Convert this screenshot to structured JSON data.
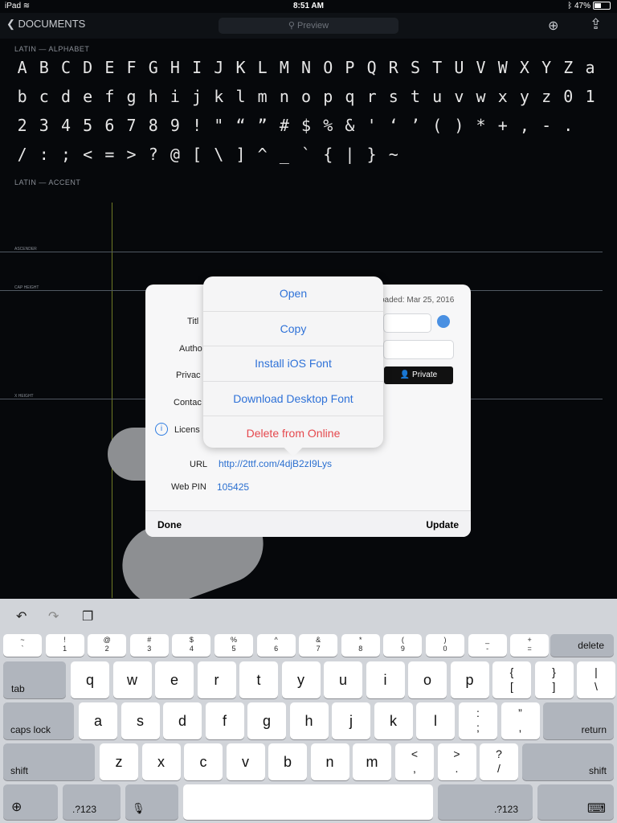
{
  "status": {
    "device": "iPad",
    "wifi": "wifi-icon",
    "time": "8:51 AM",
    "bluetooth": "bluetooth-icon",
    "battery": "47%"
  },
  "nav": {
    "back_label": "DOCUMENTS",
    "search_placeholder": "Preview"
  },
  "glyphs": {
    "section1": "LATIN — ALPHABET",
    "section2": "LATIN — ACCENT",
    "rows": [
      [
        "A",
        "B",
        "C",
        "D",
        "E",
        "F",
        "G",
        "H",
        "I",
        "J",
        "K",
        "L",
        "M",
        "N",
        "O",
        "P",
        "Q",
        "R",
        "S",
        "T",
        "U",
        "V",
        "W",
        "X",
        "Y",
        "Z",
        "a"
      ],
      [
        "b",
        "c",
        "d",
        "e",
        "f",
        "g",
        "h",
        "i",
        "j",
        "k",
        "l",
        "m",
        "n",
        "o",
        "p",
        "q",
        "r",
        "s",
        "t",
        "u",
        "v",
        "w",
        "x",
        "y",
        "z",
        "0",
        "1"
      ],
      [
        "2",
        "3",
        "4",
        "5",
        "6",
        "7",
        "8",
        "9",
        "!",
        "\"",
        "“",
        "”",
        "#",
        "$",
        "%",
        "&",
        "'",
        "‘",
        "’",
        "(",
        ")",
        "*",
        "+",
        ",",
        "-",
        "."
      ],
      [
        "/",
        ":",
        ";",
        "<",
        "=",
        ">",
        "?",
        "@",
        "[",
        "\\",
        "]",
        "^",
        "_",
        "`",
        "{",
        "|",
        "}",
        "~"
      ]
    ]
  },
  "canvas": {
    "ascender": "ASCENDER",
    "cap_height": "CAP HEIGHT",
    "x_height": "X HEIGHT"
  },
  "sheet": {
    "uploaded": "oaded: Mar 25, 2016",
    "title_label": "Titl",
    "author_label": "Autho",
    "privacy_label": "Privac",
    "contact_label": "Contac",
    "license_label": "Licens",
    "private_button": "Private",
    "url_label": "URL",
    "url_value": "http://2ttf.com/4djB2zI9Lys",
    "pin_label": "Web PIN",
    "pin_value": "105425",
    "done": "Done",
    "update": "Update"
  },
  "menu": {
    "items": [
      "Open",
      "Copy",
      "Install iOS Font",
      "Download Desktop Font",
      "Delete from Online"
    ]
  },
  "keyboard": {
    "num_row": [
      [
        "~",
        "`"
      ],
      [
        "!",
        "1"
      ],
      [
        "@",
        "2"
      ],
      [
        "#",
        "3"
      ],
      [
        "$",
        "4"
      ],
      [
        "%",
        "5"
      ],
      [
        "^",
        "6"
      ],
      [
        "&",
        "7"
      ],
      [
        "*",
        "8"
      ],
      [
        "(",
        "9"
      ],
      [
        ")",
        "0"
      ],
      [
        "_",
        "-"
      ],
      [
        "+",
        "="
      ]
    ],
    "delete": "delete",
    "row1": [
      "q",
      "w",
      "e",
      "r",
      "t",
      "y",
      "u",
      "i",
      "o",
      "p"
    ],
    "row1_sym": [
      [
        "{",
        "["
      ],
      [
        "}",
        "]"
      ],
      [
        "|",
        "\\"
      ]
    ],
    "tab": "tab",
    "row2": [
      "a",
      "s",
      "d",
      "f",
      "g",
      "h",
      "j",
      "k",
      "l"
    ],
    "row2_sym": [
      [
        ":",
        ";"
      ],
      [
        "”",
        ","
      ]
    ],
    "caps": "caps lock",
    "return": "return",
    "row3": [
      "z",
      "x",
      "c",
      "v",
      "b",
      "n",
      "m"
    ],
    "row3_sym": [
      [
        "<",
        ","
      ],
      [
        ">",
        "."
      ],
      [
        "?",
        "/"
      ]
    ],
    "shift": "shift",
    "num_mode": ".?123"
  }
}
